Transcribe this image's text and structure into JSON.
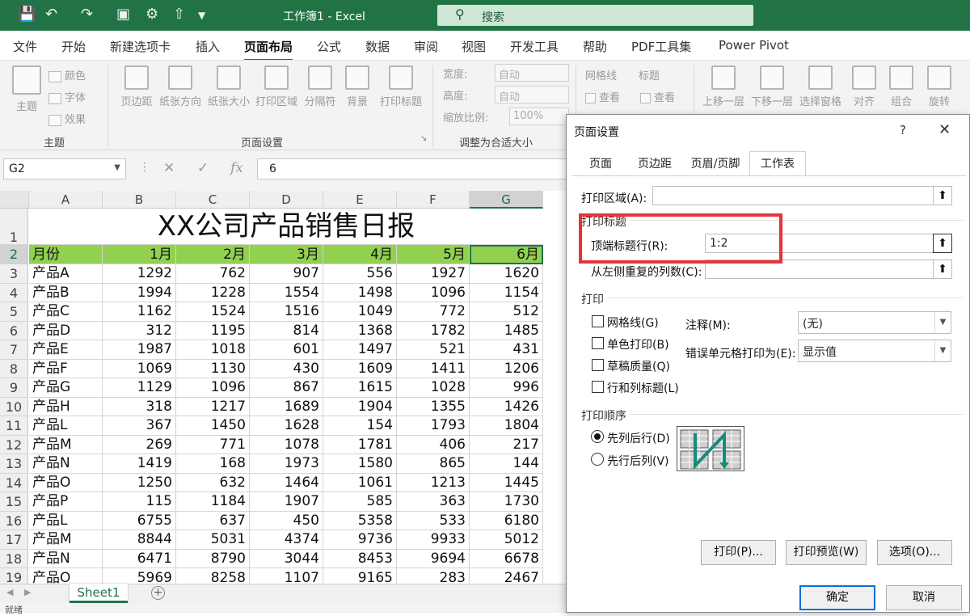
{
  "titlebar": {
    "title": "工作簿1 - Excel",
    "search_placeholder": "搜索",
    "search_icon": "search-icon",
    "quick_access": [
      "save-icon",
      "undo-icon",
      "redo-icon",
      "form-icon",
      "settings-icon",
      "customize-icon"
    ]
  },
  "menu": {
    "tabs": [
      "文件",
      "开始",
      "新建选项卡",
      "插入",
      "页面布局",
      "公式",
      "数据",
      "审阅",
      "视图",
      "开发工具",
      "帮助",
      "PDF工具集",
      "Power Pivot"
    ],
    "active": "页面布局"
  },
  "ribbon": {
    "theme": {
      "main": "主题",
      "colors": "颜色",
      "fonts": "字体",
      "effects": "效果",
      "group": "主题"
    },
    "page_setup": {
      "margins": "页边距",
      "orientation": "纸张方向",
      "size": "纸张大小",
      "print_area": "打印区域",
      "breaks": "分隔符",
      "background": "背景",
      "print_titles": "打印标题",
      "group": "页面设置"
    },
    "scale": {
      "width_label": "宽度:",
      "width_value": "自动",
      "height_label": "高度:",
      "height_value": "自动",
      "scale_label": "缩放比例:",
      "scale_value": "100%",
      "group": "调整为合适大小"
    },
    "sheet_options": {
      "gridlines": "网格线",
      "view": "查看",
      "headings": "标题",
      "view2": "查看"
    },
    "arrange": {
      "bring_forward": "上移一层",
      "send_backward": "下移一层",
      "selection_pane": "选择窗格",
      "align": "对齐",
      "group": "组合",
      "rotate": "旋转"
    }
  },
  "formula_bar": {
    "name_box": "G2",
    "formula": "6",
    "fx": "fx"
  },
  "sheet": {
    "columns": [
      "A",
      "B",
      "C",
      "D",
      "E",
      "F",
      "G"
    ],
    "title": "XX公司产品销售日报",
    "header": [
      "月份",
      "1月",
      "2月",
      "3月",
      "4月",
      "5月",
      "6月"
    ],
    "rows": [
      [
        "产品A",
        "1292",
        "762",
        "907",
        "556",
        "1927",
        "1620"
      ],
      [
        "产品B",
        "1994",
        "1228",
        "1554",
        "1498",
        "1096",
        "1154"
      ],
      [
        "产品C",
        "1162",
        "1524",
        "1516",
        "1049",
        "772",
        "512"
      ],
      [
        "产品D",
        "312",
        "1195",
        "814",
        "1368",
        "1782",
        "1485"
      ],
      [
        "产品E",
        "1987",
        "1018",
        "601",
        "1497",
        "521",
        "431"
      ],
      [
        "产品F",
        "1069",
        "1130",
        "430",
        "1609",
        "1411",
        "1206"
      ],
      [
        "产品G",
        "1129",
        "1096",
        "867",
        "1615",
        "1028",
        "996"
      ],
      [
        "产品H",
        "318",
        "1217",
        "1689",
        "1904",
        "1355",
        "1426"
      ],
      [
        "产品L",
        "367",
        "1450",
        "1628",
        "154",
        "1793",
        "1804"
      ],
      [
        "产品M",
        "269",
        "771",
        "1078",
        "1781",
        "406",
        "217"
      ],
      [
        "产品N",
        "1419",
        "168",
        "1973",
        "1580",
        "865",
        "144"
      ],
      [
        "产品O",
        "1250",
        "632",
        "1464",
        "1061",
        "1213",
        "1445"
      ],
      [
        "产品P",
        "115",
        "1184",
        "1907",
        "585",
        "363",
        "1730"
      ],
      [
        "产品L",
        "6755",
        "637",
        "450",
        "5358",
        "533",
        "6180"
      ],
      [
        "产品M",
        "8844",
        "5031",
        "4374",
        "9736",
        "9933",
        "5012"
      ],
      [
        "产品N",
        "6471",
        "8790",
        "3044",
        "8453",
        "9694",
        "6678"
      ],
      [
        "产品O",
        "5969",
        "8258",
        "1107",
        "9165",
        "283",
        "2467"
      ]
    ],
    "row_numbers": [
      "1",
      "2",
      "3",
      "4",
      "5",
      "6",
      "7",
      "8",
      "9",
      "10",
      "11",
      "12",
      "13",
      "14",
      "15",
      "16",
      "17",
      "18",
      "19"
    ],
    "tab": "Sheet1",
    "header_fill": "#92d050"
  },
  "status": {
    "left": "就绪"
  },
  "dialog": {
    "title": "页面设置",
    "help": "?",
    "tabs": [
      "页面",
      "页边距",
      "页眉/页脚",
      "工作表"
    ],
    "active_tab": "工作表",
    "print_area_label": "打印区域(A):",
    "print_area_value": "",
    "print_titles_section": "打印标题",
    "top_rows_label": "顶端标题行(R):",
    "top_rows_value": "1:2",
    "left_cols_label": "从左侧重复的列数(C):",
    "left_cols_value": "",
    "print_section": "打印",
    "gridlines": "网格线(G)",
    "black_white": "单色打印(B)",
    "draft": "草稿质量(Q)",
    "row_col_headings": "行和列标题(L)",
    "comments_label": "注释(M):",
    "comments_value": "(无)",
    "errors_label": "错误单元格打印为(E):",
    "errors_value": "显示值",
    "order_section": "打印顺序",
    "down_then_over": "先列后行(D)",
    "over_then_down": "先行后列(V)",
    "print_btn": "打印(P)...",
    "preview_btn": "打印预览(W)",
    "options_btn": "选项(O)...",
    "ok_btn": "确定",
    "cancel_btn": "取消",
    "highlight_color": "#e8323a"
  }
}
